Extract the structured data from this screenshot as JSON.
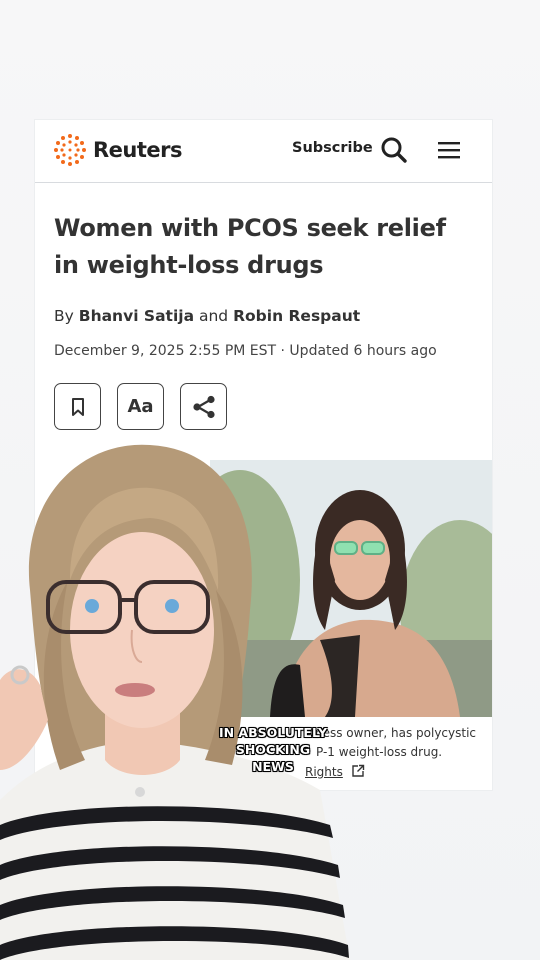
{
  "header": {
    "brand": "Reuters",
    "subscribe_label": "Subscribe",
    "icons": [
      "reuters-logo-icon",
      "search-icon",
      "menu-icon"
    ]
  },
  "article": {
    "headline": "Women with PCOS seek relief in weight-loss drugs",
    "byline_prefix": "By",
    "author1": "Bhanvi Satija",
    "byline_and": "and",
    "author2": "Robin Respaut",
    "dateline": "December 9, 2025 2:55 PM EST · Updated 6 hours ago",
    "tools": {
      "bookmark_icon": "bookmark-icon",
      "text_size_label": "Aa",
      "share_icon": "share-icon"
    },
    "caption_line1": "ness owner, has polycystic",
    "caption_line2": "P-1 weight-loss drug.",
    "caption_line3": "Rights"
  },
  "overlay": {
    "caption_line1": "IN ABSOLUTELY",
    "caption_line2": "SHOCKING NEWS"
  },
  "colors": {
    "reuters_orange": "#f26a1b",
    "text_dark": "#333333",
    "background": "#f3f4f6"
  }
}
